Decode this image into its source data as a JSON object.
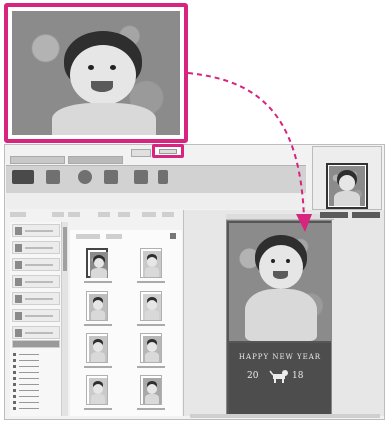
{
  "card": {
    "greeting": "HAPPY NEW YEAR",
    "year_left": "20",
    "year_right": "18"
  },
  "colors": {
    "highlight": "#d6247f",
    "arrow": "#d6247f"
  },
  "icons": {
    "drag_arrow": "dashed-curved-arrow-icon",
    "dog": "dog-icon"
  }
}
